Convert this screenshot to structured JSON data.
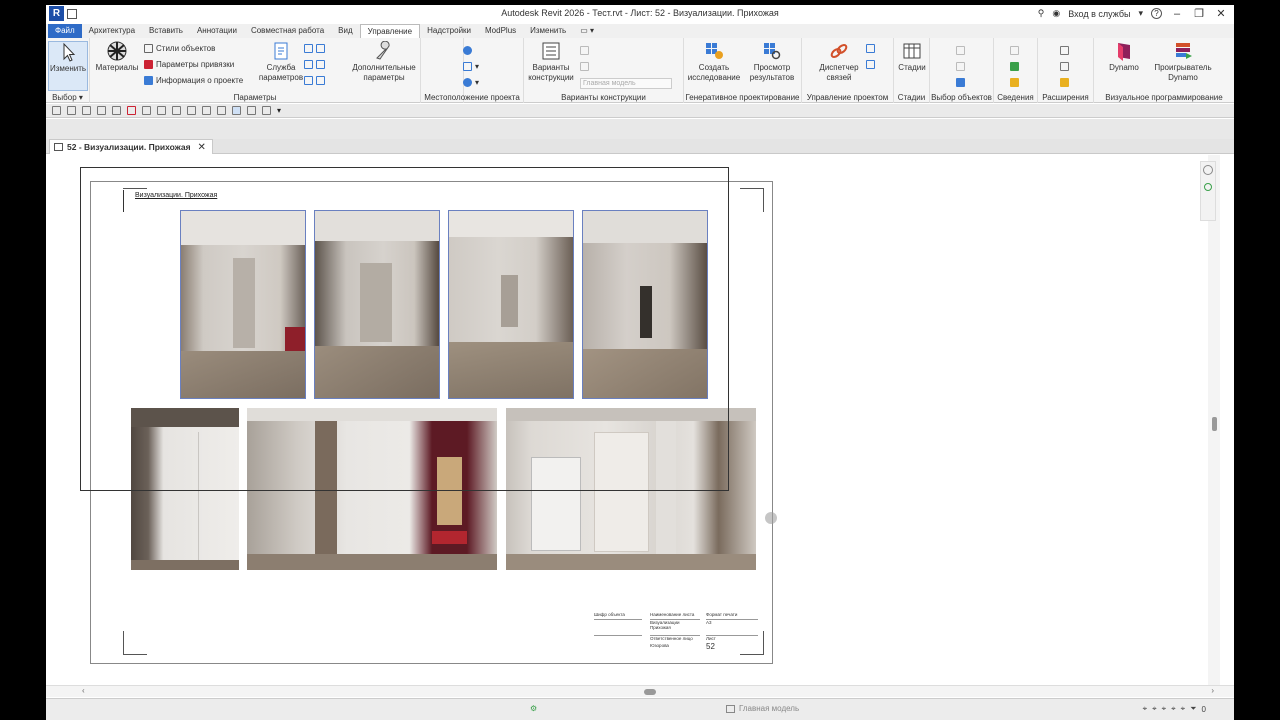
{
  "window": {
    "app_logo": "R",
    "title": "Autodesk Revit 2026 - Тест.rvt - Лист: 52 - Визуализации. Прихожая",
    "signin": "Вход в службы",
    "help": "?"
  },
  "menu_tabs": [
    "Файл",
    "Архитектура",
    "Вставить",
    "Аннотации",
    "Совместная работа",
    "Вид",
    "Управление",
    "Надстройки",
    "ModPlus",
    "Изменить"
  ],
  "active_tab": "Управление",
  "ribbon": {
    "modify_label": "Изменить",
    "materials_label": "Материалы",
    "object_styles": "Стили объектов",
    "snap_settings": "Параметры привязки",
    "project_info": "Информация о проекте",
    "service_params_1": "Служба",
    "service_params_2": "параметров",
    "additional_params_1": "Дополнительные",
    "additional_params_2": "параметры",
    "design_options_1": "Варианты",
    "design_options_2": "конструкции",
    "main_model": "Главная модель",
    "create_study_1": "Создать",
    "create_study_2": "исследование",
    "view_results_1": "Просмотр",
    "view_results_2": "результатов",
    "link_manager_1": "Диспетчер",
    "link_manager_2": "связей",
    "phases": "Стадии",
    "dynamo": "Dynamo",
    "dynamo_player_1": "Проигрыватель",
    "dynamo_player_2": "Dynamo",
    "panels": {
      "select": "Выбор",
      "parameters": "Параметры",
      "location": "Местоположение проекта",
      "design_options": "Варианты конструкции",
      "generative": "Генеративное проектирование",
      "project_mgmt": "Управление проектом",
      "phases": "Стадии",
      "selection": "Выбор объектов",
      "inquiry": "Сведения",
      "macros": "Расширения",
      "visual_programming": "Визуальное программирование"
    }
  },
  "document_tab": {
    "label": "52 - Визуализации. Прихожая",
    "close": "✕"
  },
  "sheet": {
    "view_title": "Визуализации. Прихожая",
    "images_top": [
      "corridor-render-1",
      "corridor-render-2",
      "corridor-render-3",
      "corridor-render-4"
    ],
    "images_bottom": [
      "wardrobe-render",
      "hallway-wardrobe-render",
      "entrance-door-render"
    ],
    "title_block": {
      "cell_a": "Шифр объекта",
      "cell_b1": "Наименование листа",
      "cell_b2": "Визуализации",
      "cell_b3": "Прихожая",
      "cell_c1": "Формат печати",
      "cell_c2": "А3",
      "cell_d1": "Ответственное лицо",
      "cell_d2": "Юзорова",
      "cell_e": "Лист",
      "sheet_number": "52"
    }
  },
  "statusbar": {
    "model": "Главная модель",
    "filter_count": "0"
  }
}
